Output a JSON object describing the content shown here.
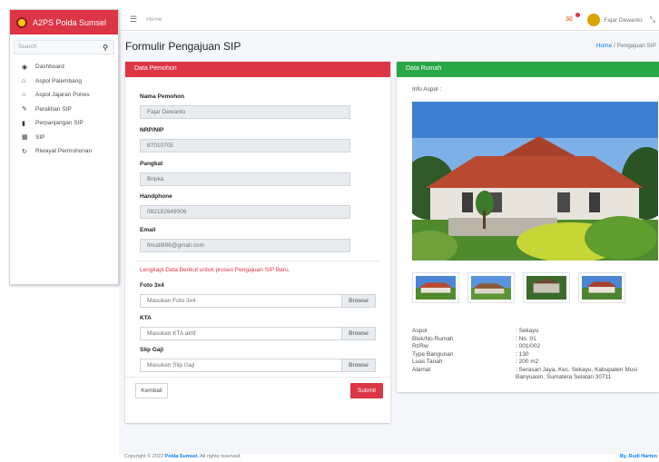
{
  "brand": {
    "name": "A2PS Polda Sumsel"
  },
  "sidebar": {
    "search_placeholder": "Search",
    "items": [
      {
        "label": "Dashboard",
        "icon": "dashboard-icon"
      },
      {
        "label": "Aspol Palembang",
        "icon": "home-icon"
      },
      {
        "label": "Aspol Jajaran Polres",
        "icon": "home-icon"
      },
      {
        "label": "Peralihan SIP",
        "icon": "edit-icon"
      },
      {
        "label": "Perpanjangan SIP",
        "icon": "file-icon"
      },
      {
        "label": "SIP",
        "icon": "document-icon"
      },
      {
        "label": "Riwayat Permohonan",
        "icon": "history-icon"
      }
    ]
  },
  "topbar": {
    "home": "Home",
    "user": "Fajar Dewanto"
  },
  "page": {
    "title": "Formulir Pengajuan SIP",
    "breadcrumb_home": "Home",
    "breadcrumb_current": "Pengajuan SIP"
  },
  "pemohon": {
    "header": "Data Pemohon",
    "fields": [
      {
        "label": "Nama Pemohon",
        "value": "Fajar Dewanto"
      },
      {
        "label": "NRP/NIP",
        "value": "87010705"
      },
      {
        "label": "Pangkat",
        "value": "Bripka"
      },
      {
        "label": "Handphone",
        "value": "082182649006"
      },
      {
        "label": "Email",
        "value": "fmudi996@gmail.com"
      }
    ],
    "note": "Lengkapi Data Berikut untuk proses Pengajuan SIP Baru.",
    "uploads": [
      {
        "label": "Foto 3x4",
        "placeholder": "Masukan Foto 3x4",
        "button": "Browse"
      },
      {
        "label": "KTA",
        "placeholder": "Masukan KTA aktif",
        "button": "Browse"
      },
      {
        "label": "Slip Gaji",
        "placeholder": "Masukan Slip Gaji",
        "button": "Browse"
      }
    ],
    "back_label": "Kembali",
    "submit_label": "Submit"
  },
  "rumah": {
    "header": "Data Rumah",
    "info_label": "Info Aspol :",
    "details": [
      {
        "key": "Aspol",
        "value": ": Sekayu"
      },
      {
        "key": "Blok/No.Rumah",
        "value": ": No. 01"
      },
      {
        "key": "Rt/Rw",
        "value": ": 001/002"
      },
      {
        "key": "Type Bangunan",
        "value": ": 130"
      },
      {
        "key": "Luas Tanah",
        "value": ": 200 m2"
      },
      {
        "key": "Alamat",
        "value": ": Serasan Jaya, Kec. Sekayu, Kabupaten Musi Banyuasin, Sumatera Selatan 30711"
      }
    ]
  },
  "footer": {
    "copyright_prefix": "Copyright © 2022 ",
    "copyright_org": "Polda Sumsel.",
    "copyright_suffix": " All rights reserved.",
    "byline": "By. Rudi Harton"
  }
}
